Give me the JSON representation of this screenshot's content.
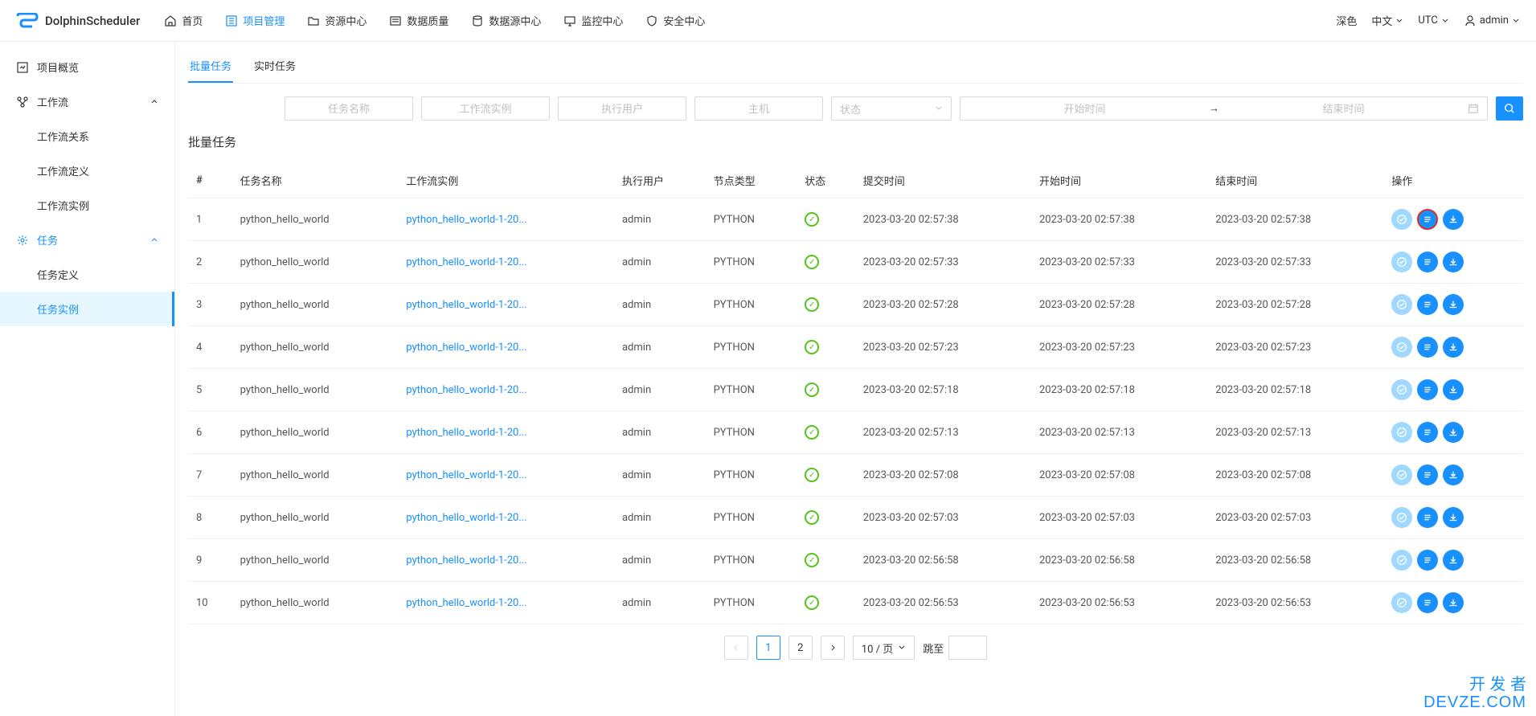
{
  "brand": "DolphinScheduler",
  "nav": {
    "home": "首页",
    "projects": "项目管理",
    "resources": "资源中心",
    "data_quality": "数据质量",
    "datasource": "数据源中心",
    "monitor": "监控中心",
    "security": "安全中心"
  },
  "header_right": {
    "theme": "深色",
    "lang": "中文",
    "tz": "UTC",
    "user": "admin"
  },
  "sidebar": {
    "overview": "项目概览",
    "workflow": "工作流",
    "workflow_relation": "工作流关系",
    "workflow_definition": "工作流定义",
    "workflow_instance": "工作流实例",
    "task": "任务",
    "task_definition": "任务定义",
    "task_instance": "任务实例"
  },
  "tabs": {
    "batch": "批量任务",
    "realtime": "实时任务"
  },
  "filters": {
    "task_name_ph": "任务名称",
    "workflow_instance_ph": "工作流实例",
    "executor_ph": "执行用户",
    "host_ph": "主机",
    "state_ph": "状态",
    "start_ph": "开始时间",
    "end_ph": "结束时间"
  },
  "section_title": "批量任务",
  "columns": {
    "index": "#",
    "task_name": "任务名称",
    "workflow_instance": "工作流实例",
    "executor": "执行用户",
    "node_type": "节点类型",
    "state": "状态",
    "submit_time": "提交时间",
    "start_time": "开始时间",
    "end_time": "结束时间",
    "operation": "操作"
  },
  "rows": [
    {
      "idx": "1",
      "task": "python_hello_world",
      "wf": "python_hello_world-1-20...",
      "user": "admin",
      "type": "PYTHON",
      "submit": "2023-03-20 02:57:38",
      "start": "2023-03-20 02:57:38",
      "end": "2023-03-20 02:57:38"
    },
    {
      "idx": "2",
      "task": "python_hello_world",
      "wf": "python_hello_world-1-20...",
      "user": "admin",
      "type": "PYTHON",
      "submit": "2023-03-20 02:57:33",
      "start": "2023-03-20 02:57:33",
      "end": "2023-03-20 02:57:33"
    },
    {
      "idx": "3",
      "task": "python_hello_world",
      "wf": "python_hello_world-1-20...",
      "user": "admin",
      "type": "PYTHON",
      "submit": "2023-03-20 02:57:28",
      "start": "2023-03-20 02:57:28",
      "end": "2023-03-20 02:57:28"
    },
    {
      "idx": "4",
      "task": "python_hello_world",
      "wf": "python_hello_world-1-20...",
      "user": "admin",
      "type": "PYTHON",
      "submit": "2023-03-20 02:57:23",
      "start": "2023-03-20 02:57:23",
      "end": "2023-03-20 02:57:23"
    },
    {
      "idx": "5",
      "task": "python_hello_world",
      "wf": "python_hello_world-1-20...",
      "user": "admin",
      "type": "PYTHON",
      "submit": "2023-03-20 02:57:18",
      "start": "2023-03-20 02:57:18",
      "end": "2023-03-20 02:57:18"
    },
    {
      "idx": "6",
      "task": "python_hello_world",
      "wf": "python_hello_world-1-20...",
      "user": "admin",
      "type": "PYTHON",
      "submit": "2023-03-20 02:57:13",
      "start": "2023-03-20 02:57:13",
      "end": "2023-03-20 02:57:13"
    },
    {
      "idx": "7",
      "task": "python_hello_world",
      "wf": "python_hello_world-1-20...",
      "user": "admin",
      "type": "PYTHON",
      "submit": "2023-03-20 02:57:08",
      "start": "2023-03-20 02:57:08",
      "end": "2023-03-20 02:57:08"
    },
    {
      "idx": "8",
      "task": "python_hello_world",
      "wf": "python_hello_world-1-20...",
      "user": "admin",
      "type": "PYTHON",
      "submit": "2023-03-20 02:57:03",
      "start": "2023-03-20 02:57:03",
      "end": "2023-03-20 02:57:03"
    },
    {
      "idx": "9",
      "task": "python_hello_world",
      "wf": "python_hello_world-1-20...",
      "user": "admin",
      "type": "PYTHON",
      "submit": "2023-03-20 02:56:58",
      "start": "2023-03-20 02:56:58",
      "end": "2023-03-20 02:56:58"
    },
    {
      "idx": "10",
      "task": "python_hello_world",
      "wf": "python_hello_world-1-20...",
      "user": "admin",
      "type": "PYTHON",
      "submit": "2023-03-20 02:56:53",
      "start": "2023-03-20 02:56:53",
      "end": "2023-03-20 02:56:53"
    }
  ],
  "pagination": {
    "page1": "1",
    "page2": "2",
    "page_size": "10 / 页",
    "jump_label": "跳至"
  },
  "watermark": {
    "line1": "开 发 者",
    "line2": "DEVZE.COM"
  }
}
